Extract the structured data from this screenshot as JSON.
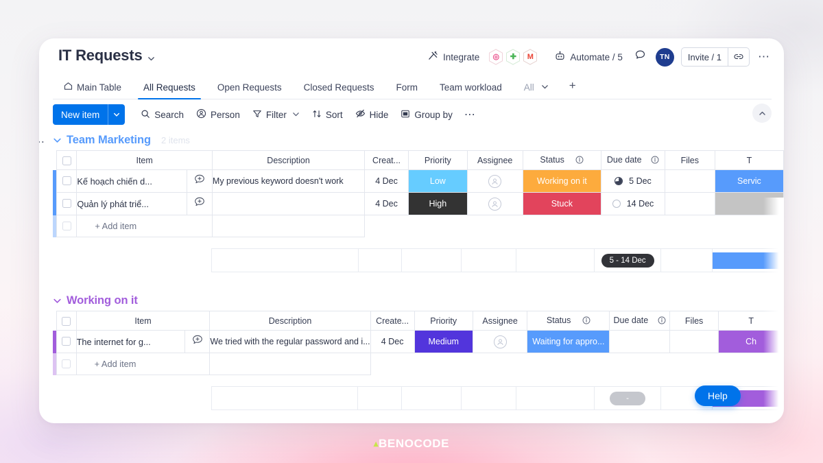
{
  "header": {
    "board_title": "IT Requests",
    "title_caret_icon": "chevron-down-icon",
    "integrate_label": "Integrate",
    "integrate_icon": "integrate-icon",
    "integration_apps": [
      {
        "name": "dribbble-icon",
        "glyph": "◎",
        "color": "#ea4c89"
      },
      {
        "name": "slack-icon",
        "glyph": "✚",
        "color": "#4ab557"
      },
      {
        "name": "gmail-icon",
        "glyph": "M",
        "color": "#ea4335"
      }
    ],
    "automate_label": "Automate / 5",
    "automate_icon": "robot-icon",
    "chat_icon": "comment-icon",
    "avatar_initials": "TN",
    "invite_label": "Invite / 1",
    "invite_link_icon": "link-icon",
    "more_icon": "more-horizontal-icon"
  },
  "tabs": [
    {
      "label": "Main Table",
      "icon": "home-icon",
      "active": false
    },
    {
      "label": "All Requests",
      "icon": "",
      "active": true
    },
    {
      "label": "Open Requests",
      "icon": "",
      "active": false
    },
    {
      "label": "Closed Requests",
      "icon": "",
      "active": false
    },
    {
      "label": "Form",
      "icon": "",
      "active": false
    },
    {
      "label": "Team workload",
      "icon": "",
      "active": false
    }
  ],
  "tabs_trailing": {
    "all_label": "All",
    "caret_icon": "chevron-down-icon",
    "add_icon": "plus-icon"
  },
  "toolbar": {
    "new_item_label": "New item",
    "new_item_caret_icon": "chevron-down-icon",
    "search_label": "Search",
    "search_icon": "search-icon",
    "person_label": "Person",
    "person_icon": "person-icon",
    "filter_label": "Filter",
    "filter_icon": "funnel-icon",
    "filter_caret_icon": "chevron-down-icon",
    "sort_label": "Sort",
    "sort_icon": "sort-icon",
    "hide_label": "Hide",
    "hide_icon": "eye-off-icon",
    "group_by_label": "Group by",
    "group_by_icon": "group-icon",
    "more_icon": "more-horizontal-icon",
    "collapse_icon": "chevron-up-icon"
  },
  "columns": [
    "Item",
    "Description",
    "Creat...",
    "Priority",
    "Assignee",
    "Status",
    "Due date",
    "Files",
    "T"
  ],
  "columns_group2": [
    "Item",
    "Description",
    "Create...",
    "Priority",
    "Assignee",
    "Status",
    "Due date",
    "Files",
    "T"
  ],
  "groups": [
    {
      "name": "Team Marketing",
      "color": "#579bfc",
      "count_label": "2 items",
      "collapse_icon": "chevron-down-icon",
      "menu_icon": "more-horizontal-icon",
      "add_item_label": "+ Add item",
      "rows": [
        {
          "item": "Kế hoạch chiến d...",
          "comment_icon": "add-comment-icon",
          "description": "My previous keyword doesn't work",
          "created": "4 Dec",
          "priority": {
            "label": "Low",
            "color": "#66ccff"
          },
          "assignee_icon": "person-placeholder-icon",
          "status": {
            "label": "Working on it",
            "color": "#fdab3d"
          },
          "due": {
            "label": "5 Dec",
            "progress_icon": "pie-full-icon"
          },
          "files": "",
          "tail": {
            "label": "Servic",
            "color": "#579bfc"
          }
        },
        {
          "item": "Quản lý phát triể...",
          "comment_icon": "add-comment-icon",
          "description": "",
          "created": "4 Dec",
          "priority": {
            "label": "High",
            "color": "#333333"
          },
          "assignee_icon": "person-placeholder-icon",
          "status": {
            "label": "Stuck",
            "color": "#e2445c"
          },
          "due": {
            "label": "14 Dec",
            "progress_icon": "pie-empty-icon"
          },
          "files": "",
          "tail": {
            "label": "",
            "color": "#c4c4c4"
          }
        }
      ],
      "summary": {
        "due_range": "5 - 14 Dec",
        "tail_color": "#579bfc"
      }
    },
    {
      "name": "Working on it",
      "color": "#a25ddc",
      "count_label": "",
      "collapse_icon": "chevron-down-icon",
      "menu_icon": "more-horizontal-icon",
      "add_item_label": "+ Add item",
      "rows": [
        {
          "item": "The internet for g...",
          "comment_icon": "add-comment-icon",
          "description": "We tried with the regular password and i...",
          "created": "4 Dec",
          "priority": {
            "label": "Medium",
            "color": "#5235dc"
          },
          "assignee_icon": "person-placeholder-icon",
          "status": {
            "label": "Waiting for appro...",
            "color": "#579bfc"
          },
          "due": {
            "label": "",
            "progress_icon": ""
          },
          "files": "",
          "tail": {
            "label": "Ch",
            "color": "#a25ddc"
          }
        }
      ],
      "summary": {
        "due_range": "-",
        "tail_color": "#a25ddc"
      }
    }
  ],
  "help": {
    "label": "Help"
  },
  "watermark": {
    "mark": "▴",
    "text": "BENOCODE"
  }
}
